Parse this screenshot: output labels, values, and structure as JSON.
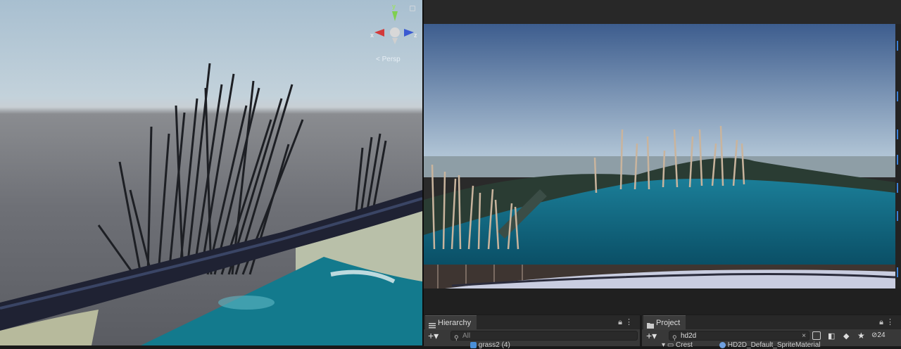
{
  "scene_view": {
    "gizmo": {
      "y_label": "y",
      "x_label": "x",
      "z_label": "z"
    },
    "projection_label": "Persp",
    "lock_icon": "lock-icon"
  },
  "hierarchy": {
    "tab_label": "Hierarchy",
    "search_placeholder": "All",
    "first_item": "grass2 (4)"
  },
  "project": {
    "tab_label": "Project",
    "search_value": "hd2d",
    "folder_item": "Crest",
    "asset_item": "HD2D_Default_SpriteMaterial",
    "hidden_count": "24"
  },
  "colors": {
    "editor_bg": "#191919",
    "panel_bg": "#383838",
    "sky_top": "#3f5f8f",
    "water": "#0e5f76"
  }
}
